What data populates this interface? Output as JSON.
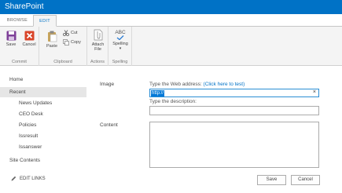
{
  "suitebar": {
    "brand": "SharePoint"
  },
  "tabs": [
    {
      "label": "BROWSE"
    },
    {
      "label": "EDIT"
    }
  ],
  "ribbon": {
    "commit": {
      "save": "Save",
      "cancel": "Cancel",
      "group": "Commit"
    },
    "clipboard": {
      "paste": "Paste",
      "cut": "Cut",
      "copy": "Copy",
      "group": "Clipboard"
    },
    "actions": {
      "attach_line1": "Attach",
      "attach_line2": "File",
      "group": "Actions"
    },
    "spelling": {
      "abc": "ABC",
      "label": "Spelling",
      "group": "Spelling"
    }
  },
  "nav": {
    "items": [
      "Home",
      "Recent",
      "News Updates",
      "CEO Desk",
      "Policies",
      "Issresult",
      "Issanswer",
      "Site Contents"
    ],
    "edit_links": "EDIT LINKS"
  },
  "form": {
    "image_label": "Image",
    "web_address_prompt": "Type the Web address: ",
    "test_link": "(Click here to test)",
    "web_address_value": "http://",
    "description_prompt": "Type the description:",
    "description_value": "",
    "content_label": "Content",
    "content_value": ""
  },
  "buttons": {
    "save": "Save",
    "cancel": "Cancel"
  }
}
